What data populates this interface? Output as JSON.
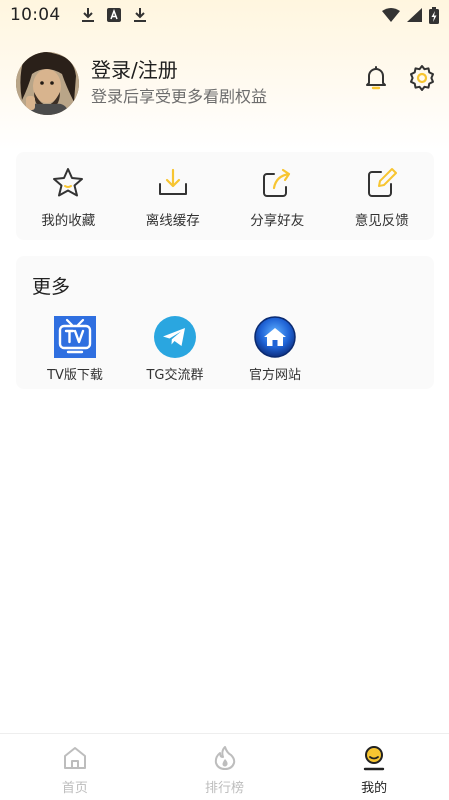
{
  "status_bar": {
    "time": "10:04",
    "left_icons": [
      "download-icon",
      "font-a-icon",
      "download-icon"
    ],
    "right_icons": [
      "wifi-icon",
      "signal-icon",
      "battery-charging-icon"
    ]
  },
  "profile": {
    "title": "登录/注册",
    "subtitle": "登录后享受更多看剧权益",
    "actions": [
      "bell-icon",
      "settings-icon"
    ]
  },
  "quick_actions": [
    {
      "label": "我的收藏",
      "icon": "star-icon"
    },
    {
      "label": "离线缓存",
      "icon": "download-tray-icon"
    },
    {
      "label": "分享好友",
      "icon": "share-icon"
    },
    {
      "label": "意见反馈",
      "icon": "edit-icon"
    }
  ],
  "more": {
    "title": "更多",
    "items": [
      {
        "label": "TV版下载",
        "icon": "tv-icon"
      },
      {
        "label": "TG交流群",
        "icon": "telegram-icon"
      },
      {
        "label": "官方网站",
        "icon": "home-globe-icon"
      }
    ]
  },
  "bottom_nav": {
    "items": [
      {
        "label": "首页",
        "icon": "home-icon"
      },
      {
        "label": "排行榜",
        "icon": "flame-icon"
      },
      {
        "label": "我的",
        "icon": "user-icon"
      }
    ],
    "active_index": 2
  },
  "colors": {
    "accent_yellow": "#f7c531",
    "icon_dark": "#333333",
    "tv_blue": "#2f6fe0",
    "telegram_blue": "#2aa6e0",
    "nav_inactive": "#bdbdbd"
  }
}
